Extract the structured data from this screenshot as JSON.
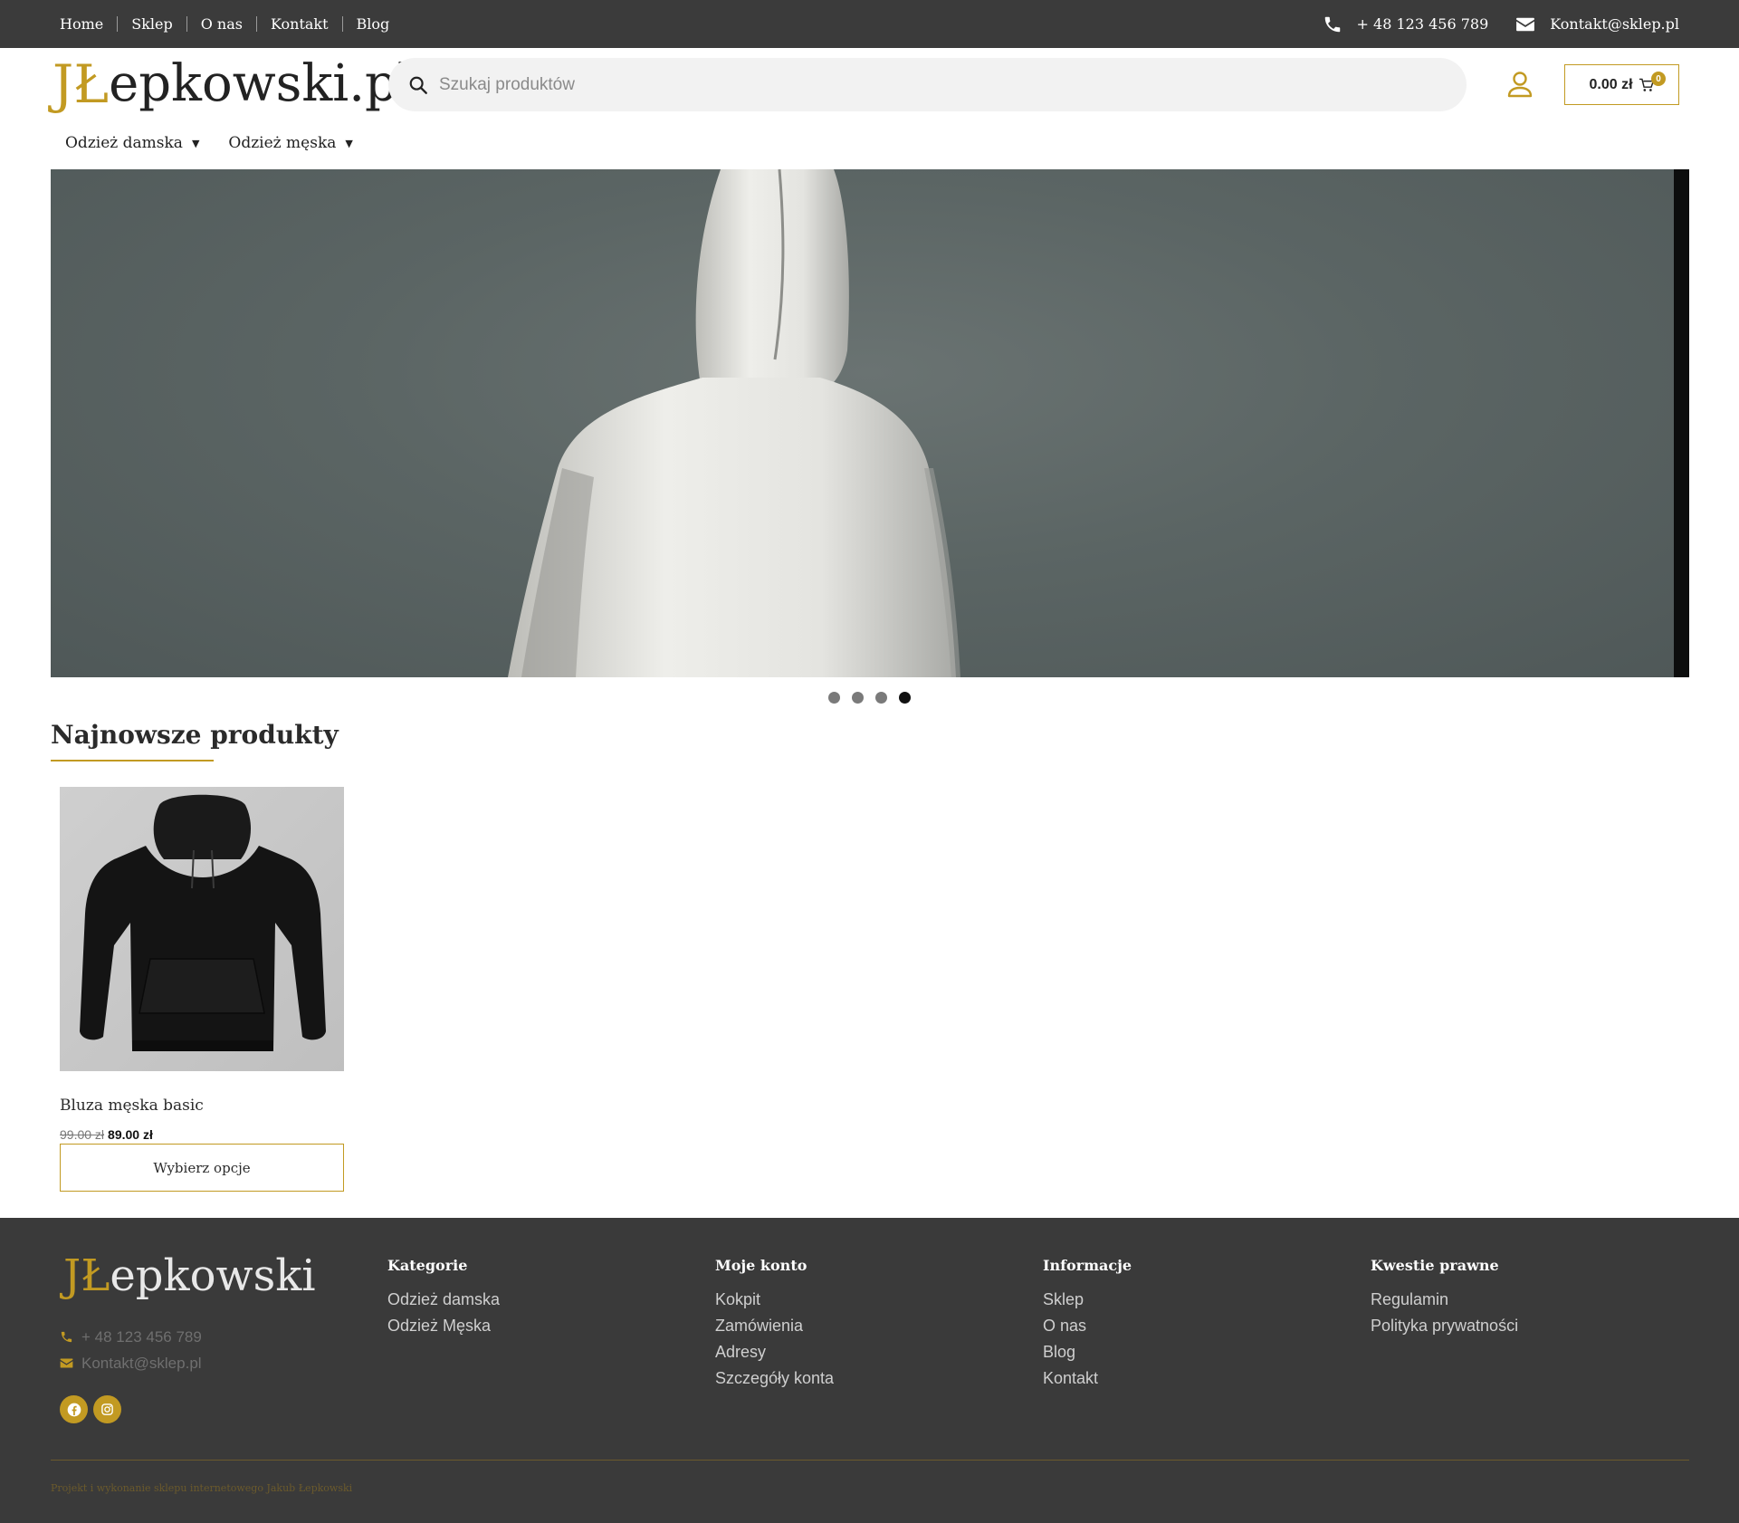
{
  "topbar": {
    "nav": [
      "Home",
      "Sklep",
      "O nas",
      "Kontakt",
      "Blog"
    ],
    "phone": "+ 48 123 456 789",
    "email": "Kontakt@sklep.pl"
  },
  "header": {
    "logo_mark": "JŁ",
    "logo_text": "epkowski.pl",
    "search_placeholder": "Szukaj produktów",
    "cart_total": "0.00 zł",
    "cart_count": "0",
    "categories": [
      "Odzież damska",
      "Odzież męska"
    ]
  },
  "hero": {
    "slides_total": 4,
    "active_slide": 4
  },
  "products": {
    "title": "Najnowsze produkty",
    "items": [
      {
        "name": "Bluza męska basic",
        "old_price": "99.00 zł",
        "price": "89.00 zł",
        "button": "Wybierz opcje"
      }
    ]
  },
  "footer": {
    "logo_mark": "JŁ",
    "logo_text": "epkowski",
    "phone": "+ 48 123 456 789",
    "email": "Kontakt@sklep.pl",
    "columns": [
      {
        "title": "Kategorie",
        "links": [
          "Odzież damska",
          "Odzież Męska"
        ]
      },
      {
        "title": "Moje konto",
        "links": [
          "Kokpit",
          "Zamówienia",
          "Adresy",
          "Szczegóły konta"
        ]
      },
      {
        "title": "Informacje",
        "links": [
          "Sklep",
          "O nas",
          "Blog",
          "Kontakt"
        ]
      },
      {
        "title": "Kwestie prawne",
        "links": [
          "Regulamin",
          "Polityka prywatności"
        ]
      }
    ],
    "copyright": "Projekt i wykonanie sklepu internetowego Jakub Łepkowski"
  },
  "colors": {
    "accent": "#c29a22",
    "dark": "#3a3a3a"
  }
}
